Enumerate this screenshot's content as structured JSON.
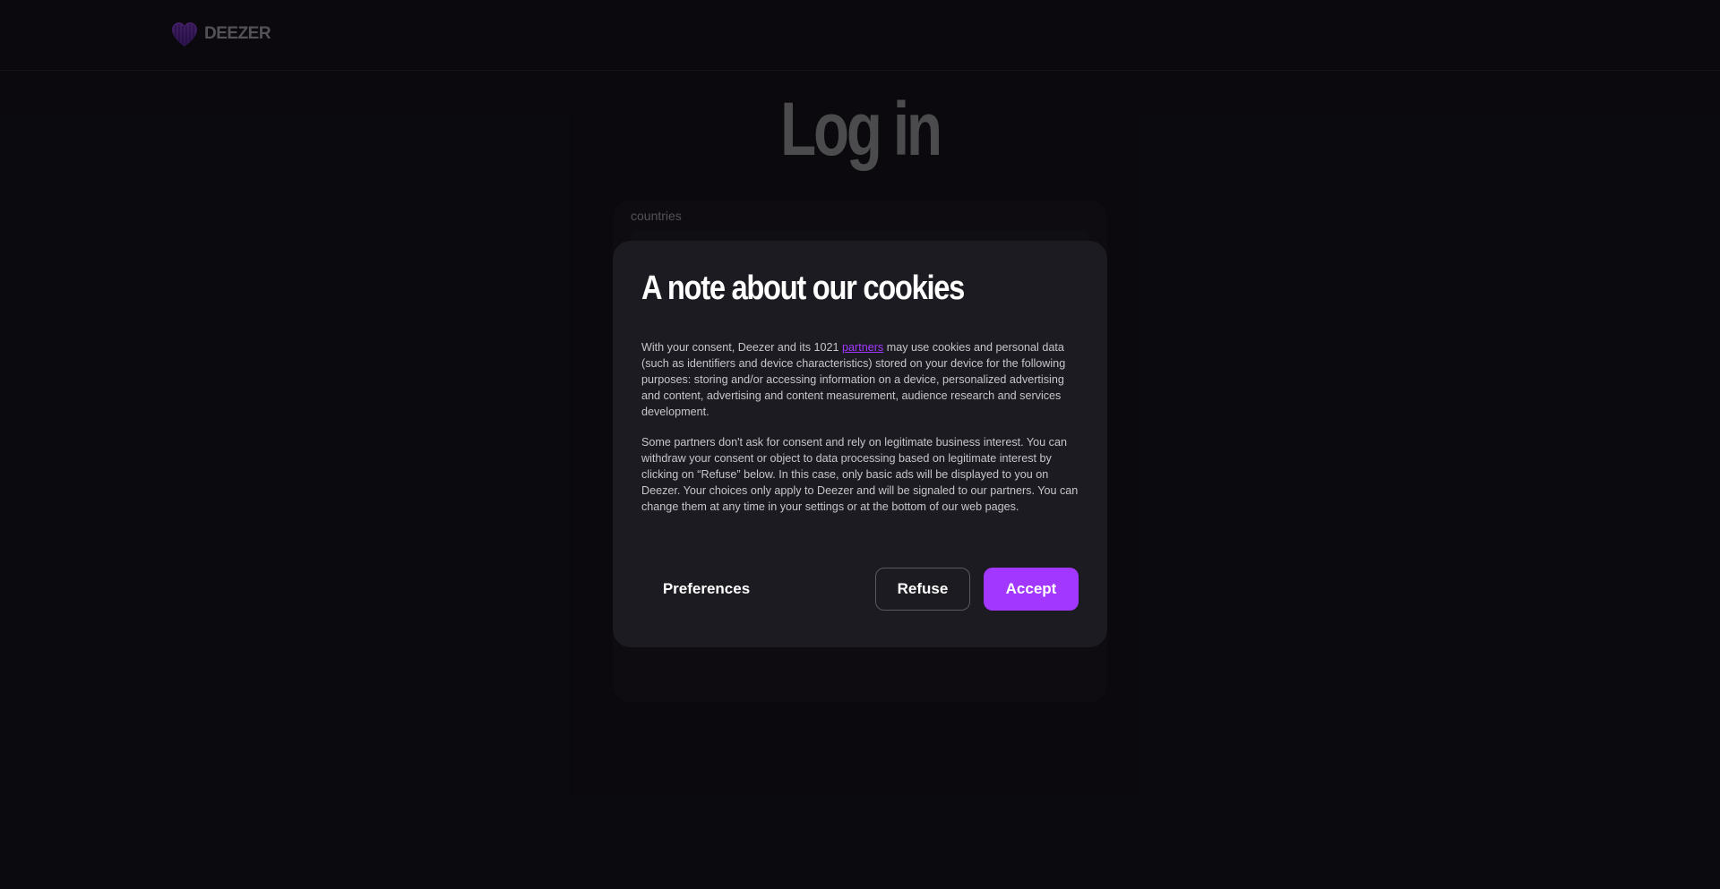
{
  "header": {
    "logo_text": "DEEZER",
    "logo_icon": "deezer-heart-icon"
  },
  "login": {
    "title": "Log in",
    "countries_label": "countries"
  },
  "cookie_dialog": {
    "title": "A note about our cookies",
    "paragraph1_before_link": "With your consent, Deezer and its 1021 ",
    "partners_link": "partners",
    "paragraph1_after_link": " may use cookies and personal data (such as identifiers and device characteristics) stored on your device for the following purposes: storing and/or accessing information on a device, personalized advertising and content, advertising and content measurement, audience research and services development.",
    "paragraph2": "Some partners don't ask for consent and rely on legitimate business interest. You can withdraw your consent or object to data processing based on legitimate interest by clicking on “Refuse” below. In this case, only basic ads will be displayed to you on Deezer. Your choices only apply to Deezer and will be signaled to our partners. You can change them at any time in your settings or at the bottom of our web pages.",
    "preferences_label": "Preferences",
    "refuse_label": "Refuse",
    "accept_label": "Accept"
  },
  "colors": {
    "accent": "#a238ff",
    "background": "#0f0d13",
    "dialog": "#1c1b21"
  }
}
